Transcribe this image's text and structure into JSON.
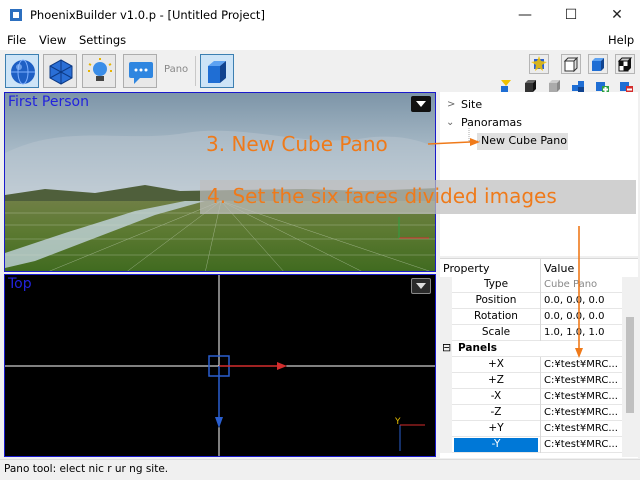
{
  "window": {
    "title": "PhoenixBuilder v1.0.p - [Untitled Project]",
    "minimize_glyph": "—",
    "maximize_glyph": "☐",
    "close_glyph": "✕"
  },
  "menu": {
    "left": [
      "File",
      "View",
      "Settings"
    ],
    "help": "Help"
  },
  "toolbar": {
    "buttons": [
      {
        "icon": "globe-icon",
        "selected": true
      },
      {
        "icon": "wireframe-icon",
        "selected": false
      },
      {
        "icon": "lightbulb-icon",
        "selected": false
      },
      {
        "icon": "message-icon",
        "selected": false
      }
    ],
    "pano_label": "Pano",
    "cube_button": {
      "icon": "cube-icon",
      "selected": true
    },
    "right_icons_row1": [
      "target-icon",
      "cube-outline-icon",
      "cube-blue-icon",
      "cube-checker-icon"
    ],
    "right_icons_row2": [
      "flag-icon",
      "dark-cube-icon",
      "gray-cube-icon",
      "multi-cube-icon",
      "add-cube-icon",
      "remove-cube-icon"
    ]
  },
  "viewports": {
    "first_person": {
      "title": "First Person"
    },
    "top": {
      "title": "Top"
    }
  },
  "tree": {
    "site": "Site",
    "panoramas": "Panoramas",
    "new_cube_pano": "New Cube Pano"
  },
  "property_grid": {
    "col_property": "Property",
    "col_value": "Value",
    "rows": [
      {
        "name": "Type",
        "value": "Cube Pano",
        "dim": true
      },
      {
        "name": "Position",
        "value": "0.0, 0.0, 0.0"
      },
      {
        "name": "Rotation",
        "value": "0.0, 0.0, 0.0"
      },
      {
        "name": "Scale",
        "value": "1.0, 1.0, 1.0"
      }
    ],
    "section": {
      "toggle": "⊟",
      "label": "Panels"
    },
    "panels": [
      {
        "name": "+X",
        "value": "C:¥test¥MRC..."
      },
      {
        "name": "+Z",
        "value": "C:¥test¥MRC..."
      },
      {
        "name": "-X",
        "value": "C:¥test¥MRC..."
      },
      {
        "name": "-Z",
        "value": "C:¥test¥MRC..."
      },
      {
        "name": "+Y",
        "value": "C:¥test¥MRC..."
      },
      {
        "name": "-Y",
        "value": "C:¥test¥MRC...",
        "selected": true
      }
    ]
  },
  "status": {
    "text": "Pano tool:  elect                nic               r    ur     ng site."
  },
  "annotations": {
    "step3": "3. New Cube Pano",
    "step4": "4. Set the six faces divided images",
    "color": "#ef7a1a"
  },
  "colors": {
    "accent_blue": "#1a1acc",
    "selection": "#0078d7"
  }
}
